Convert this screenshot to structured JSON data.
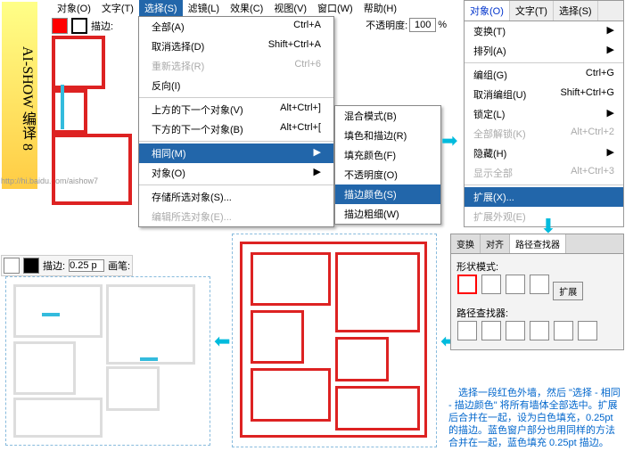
{
  "menubar": [
    "对象(O)",
    "文字(T)",
    "选择(S)",
    "滤镜(L)",
    "效果(C)",
    "视图(V)",
    "窗口(W)",
    "帮助(H)"
  ],
  "menubar_sel": 2,
  "toolbar1": {
    "stroke_label": "描边:"
  },
  "opacity": {
    "label": "不透明度:",
    "value": "100",
    "pct": "%"
  },
  "menu": {
    "items": [
      {
        "l": "全部(A)",
        "s": "Ctrl+A"
      },
      {
        "l": "取消选择(D)",
        "s": "Shift+Ctrl+A"
      },
      {
        "l": "重新选择(R)",
        "s": "Ctrl+6",
        "dis": true
      },
      {
        "l": "反向(I)"
      },
      {
        "hr": true
      },
      {
        "l": "上方的下一个对象(V)",
        "s": "Alt+Ctrl+]"
      },
      {
        "l": "下方的下一个对象(B)",
        "s": "Alt+Ctrl+["
      },
      {
        "hr": true
      },
      {
        "l": "相同(M)",
        "arrow": true,
        "hl": true
      },
      {
        "l": "对象(O)",
        "arrow": true
      },
      {
        "hr": true
      },
      {
        "l": "存储所选对象(S)..."
      },
      {
        "l": "编辑所选对象(E)...",
        "dis": true
      }
    ]
  },
  "submenu": [
    "混合模式(B)",
    "填色和描边(R)",
    "填充颜色(F)",
    "不透明度(O)",
    "描边颜色(S)",
    "描边粗细(W)"
  ],
  "submenu_hl": 4,
  "rpanel": {
    "tabs": [
      "对象(O)",
      "文字(T)",
      "选择(S)"
    ],
    "items": [
      {
        "l": "变换(T)",
        "arrow": true
      },
      {
        "l": "排列(A)",
        "arrow": true
      },
      {
        "hr": true
      },
      {
        "l": "编组(G)",
        "s": "Ctrl+G"
      },
      {
        "l": "取消编组(U)",
        "s": "Shift+Ctrl+G"
      },
      {
        "l": "锁定(L)",
        "arrow": true
      },
      {
        "l": "全部解锁(K)",
        "s": "Alt+Ctrl+2",
        "dis": true
      },
      {
        "l": "隐藏(H)",
        "arrow": true
      },
      {
        "l": "显示全部",
        "s": "Alt+Ctrl+3",
        "dis": true
      },
      {
        "hr": true
      },
      {
        "l": "扩展(X)...",
        "hl": true
      },
      {
        "l": "扩展外观(E)",
        "dis": true
      }
    ]
  },
  "toolbar2": {
    "stroke": "描边:",
    "wval": "0.25 p",
    "brush": "画笔:"
  },
  "pathpanel": {
    "tabs": [
      "变换",
      "对齐",
      "路径查找器"
    ],
    "shape": "形状模式:",
    "path": "路径查找器:",
    "expand": "扩展"
  },
  "caption": "　选择一段红色外墙，然后 \"选择 - 相同 - 描边颜色\" 将所有墙体全部选中。扩展后合并在一起，设为白色填充，0.25pt 的描边。蓝色窗户部分也用同样的方法合并在一起，蓝色填充 0.25pt 描边。",
  "url": "http://hi.baidu.com/aishow7",
  "logo": "AI-SHOW 编译 8"
}
